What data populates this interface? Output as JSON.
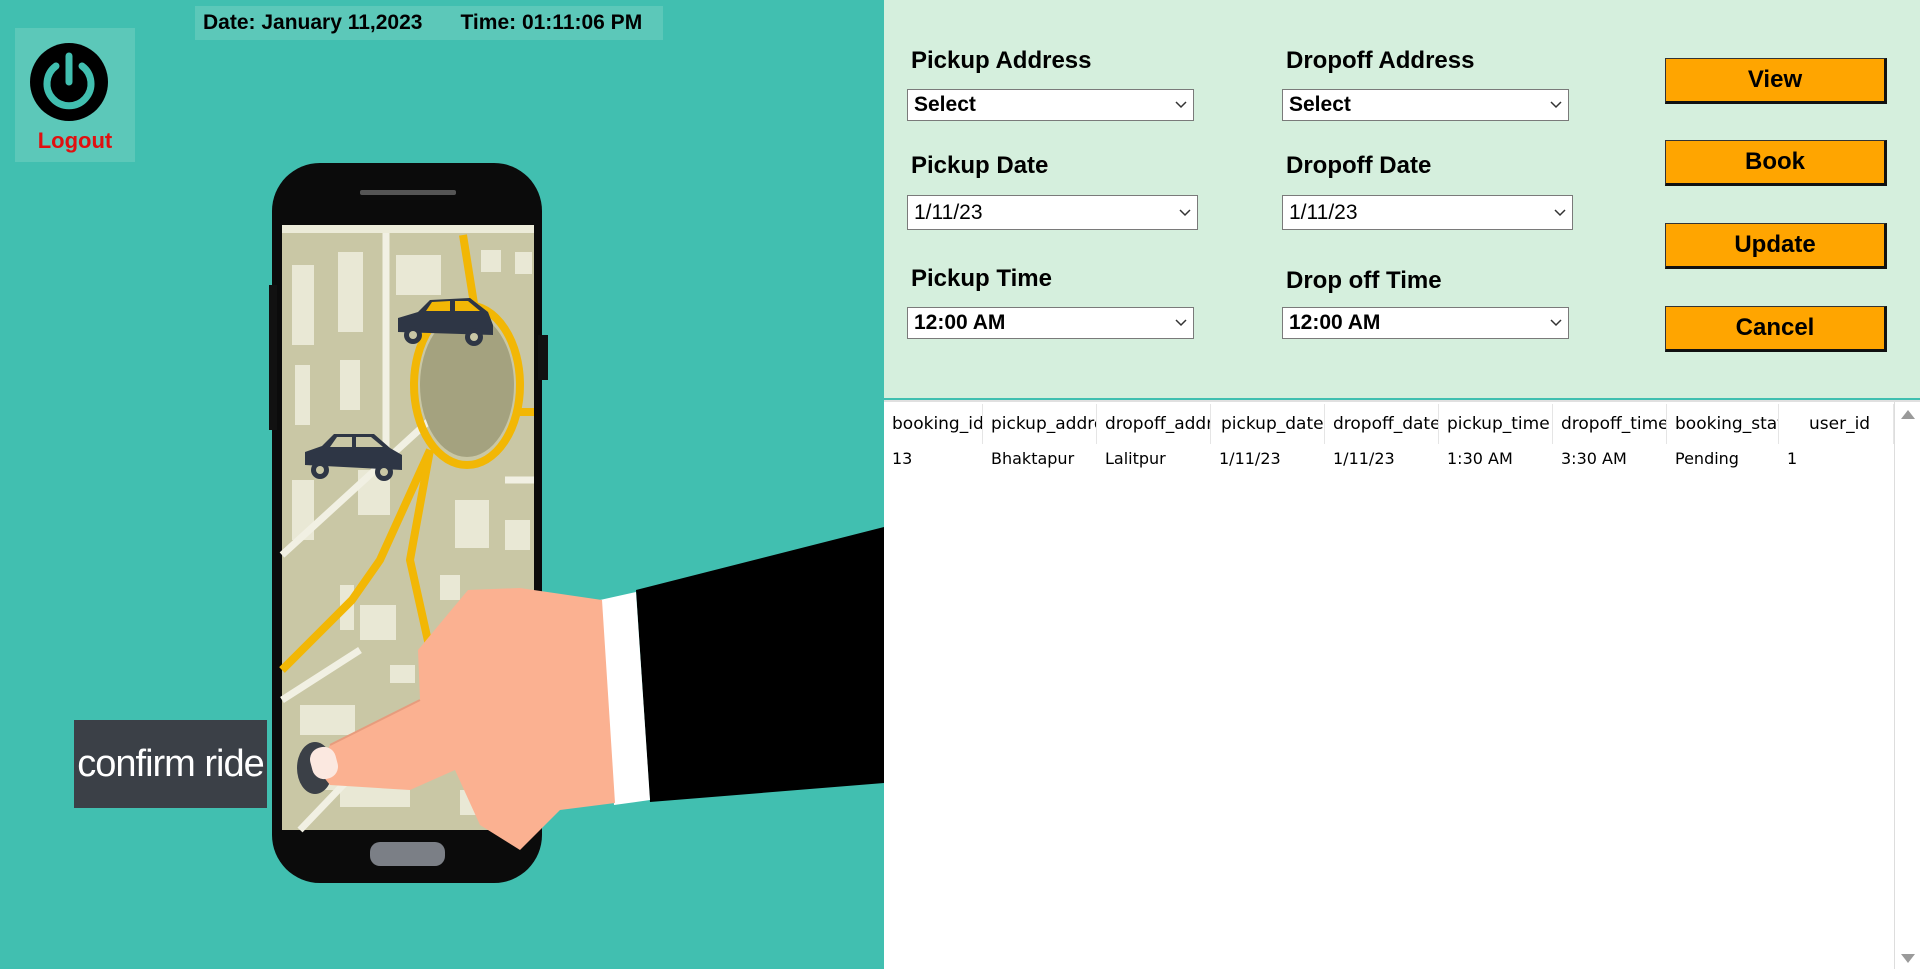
{
  "header": {
    "date": "Date: January 11,2023",
    "time": "Time: 01:11:06 PM"
  },
  "logout": {
    "label": "Logout",
    "icon": "power-icon"
  },
  "illustration": {
    "caption": "confirm ride"
  },
  "form": {
    "pickup_address": {
      "label": "Pickup Address",
      "value": "Select"
    },
    "dropoff_address": {
      "label": "Dropoff Address",
      "value": "Select"
    },
    "pickup_date": {
      "label": "Pickup Date",
      "value": "1/11/23"
    },
    "dropoff_date": {
      "label": "Dropoff Date",
      "value": "1/11/23"
    },
    "pickup_time": {
      "label": "Pickup Time",
      "value": "12:00 AM"
    },
    "dropoff_time": {
      "label": "Drop off Time",
      "value": "12:00 AM"
    }
  },
  "buttons": {
    "view": "View",
    "book": "Book",
    "update": "Update",
    "cancel": "Cancel"
  },
  "table": {
    "columns": [
      "booking_id",
      "pickup_addre",
      "dropoff_addr",
      "pickup_date",
      "dropoff_date",
      "pickup_time",
      "dropoff_time",
      "booking_stat",
      "user_id"
    ],
    "rows": [
      [
        "13",
        "Bhaktapur",
        "Lalitpur",
        "1/11/23",
        "1/11/23",
        "1:30 AM",
        "3:30 AM",
        "Pending",
        "1"
      ]
    ]
  },
  "colors": {
    "left_bg": "#41bfb0",
    "panel_bg": "#d5efdd",
    "button": "#ffa500",
    "logout_text": "#e01010"
  }
}
